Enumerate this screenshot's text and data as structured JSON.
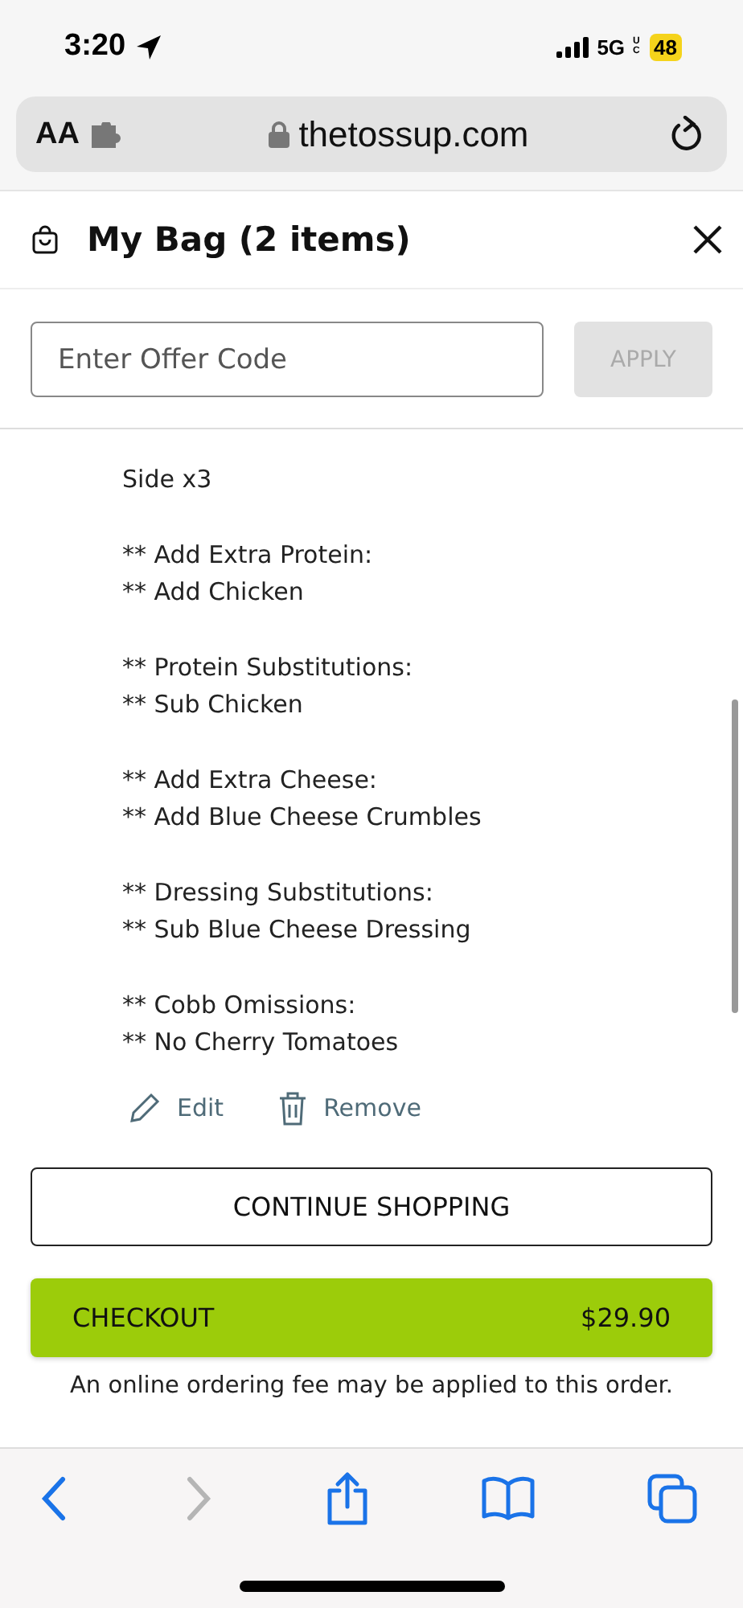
{
  "status_bar": {
    "time": "3:20",
    "network": "5G",
    "network_sub": "UC",
    "battery": "48"
  },
  "address_bar": {
    "text_size": "AA",
    "url": "thetossup.com"
  },
  "bag": {
    "title": "My Bag (2 items)"
  },
  "offer": {
    "placeholder": "Enter Offer Code",
    "apply": "APPLY",
    "apply_disabled": true
  },
  "item": {
    "notes": [
      [
        "Side x3"
      ],
      [
        "** Add Extra Protein:",
        "** Add Chicken"
      ],
      [
        "** Protein Substitutions:",
        "** Sub Chicken"
      ],
      [
        "** Add Extra Cheese:",
        "** Add Blue Cheese Crumbles"
      ],
      [
        "** Dressing Substitutions:",
        "** Sub Blue Cheese Dressing"
      ],
      [
        "** Cobb Omissions:",
        "** No Cherry Tomatoes"
      ]
    ],
    "edit": "Edit",
    "remove": "Remove"
  },
  "continue_button": "CONTINUE SHOPPING",
  "checkout": {
    "label": "CHECKOUT",
    "total": "$29.90"
  },
  "fee_note": "An online ordering fee may be applied to this order.",
  "toolbar": {
    "back_disabled": false,
    "forward_disabled": true
  }
}
